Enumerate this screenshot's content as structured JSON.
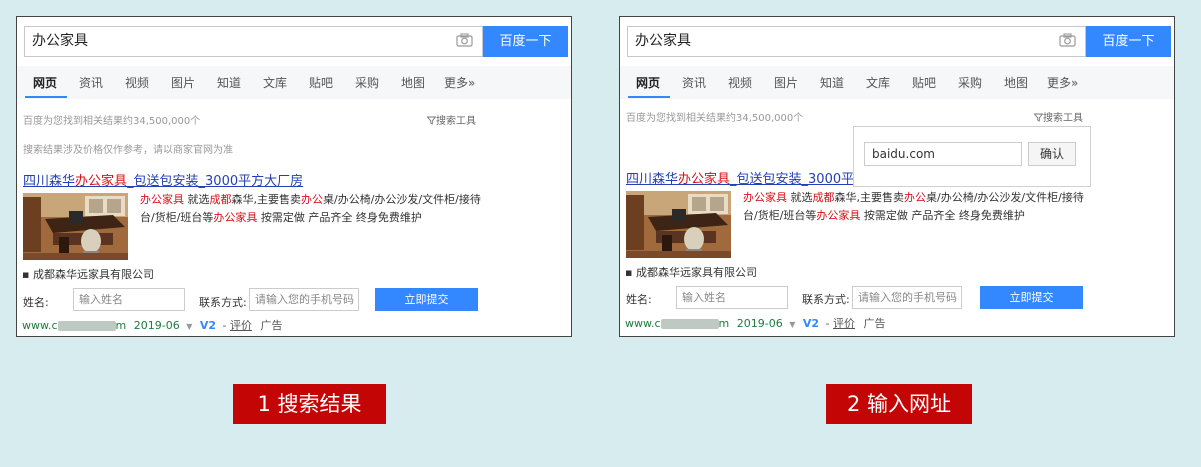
{
  "panels": [
    {
      "search_query": "办公家具",
      "search_button": "百度一下",
      "tabs": [
        "网页",
        "资讯",
        "视频",
        "图片",
        "知道",
        "文库",
        "贴吧",
        "采购",
        "地图",
        "更多»"
      ],
      "result_count": "百度为您找到相关结果约34,500,000个",
      "search_tools": "搜索工具",
      "price_notice": "搜索结果涉及价格仅作参考，请以商家官网为准",
      "result": {
        "title_prefix": "四川森华",
        "title_hl": "办公家具",
        "title_suffix": "_包送包安装_3000平方大厂房",
        "desc_hl1": "办公家具",
        "desc_t1": " 就选",
        "desc_hl2": "成都",
        "desc_t2": "森华,主要售卖",
        "desc_hl3": "办公",
        "desc_t3": "桌/办公椅/办公沙发/文件柜/接待台/货柜/班台等",
        "desc_hl4": "办公家具",
        "desc_t4": " 按需定做 产品齐全 终身免费维护",
        "company": "▪ 成都森华远家具有限公司",
        "name_label": "姓名:",
        "name_placeholder": "输入姓名",
        "contact_label": "联系方式:",
        "contact_placeholder": "请输入您的手机号码",
        "submit": "立即提交",
        "site_prefix": "www.c",
        "site_suffix": "m",
        "date": "2019-06",
        "v2": "V2",
        "rating": "评价",
        "ad": "广告"
      }
    },
    {
      "search_query": "办公家具",
      "search_button": "百度一下",
      "tabs": [
        "网页",
        "资讯",
        "视频",
        "图片",
        "知道",
        "文库",
        "贴吧",
        "采购",
        "地图",
        "更多»"
      ],
      "result_count": "百度为您找到相关结果约34,500,000个",
      "search_tools": "搜索工具",
      "result": {
        "title_prefix": "四川森华",
        "title_hl": "办公家具",
        "title_suffix": "_包送包安装_3000平",
        "desc_hl1": "办公家具",
        "desc_t1": " 就选",
        "desc_hl2": "成都",
        "desc_t2": "森华,主要售卖",
        "desc_hl3": "办公",
        "desc_t3": "桌/办公椅/办公沙发/文件柜/接待台/货柜/班台等",
        "desc_hl4": "办公家具",
        "desc_t4": " 按需定做 产品齐全 终身免费维护",
        "company": "▪ 成都森华远家具有限公司",
        "name_label": "姓名:",
        "name_placeholder": "输入姓名",
        "contact_label": "联系方式:",
        "contact_placeholder": "请输入您的手机号码",
        "submit": "立即提交",
        "site_prefix": "www.c",
        "site_suffix": "m",
        "date": "2019-06",
        "v2": "V2",
        "rating": "评价",
        "ad": "广告"
      },
      "popup": {
        "url": "baidu.com",
        "confirm": "确认"
      }
    }
  ],
  "captions": [
    "1 搜索结果",
    "2 输入网址"
  ],
  "colors": {
    "accent": "#3388ff",
    "highlight": "#d6101a",
    "link": "#2440b3",
    "caption_bg": "#c40505",
    "page_bg": "#d6ecef"
  },
  "icons": [
    "camera-icon",
    "filter-icon"
  ]
}
